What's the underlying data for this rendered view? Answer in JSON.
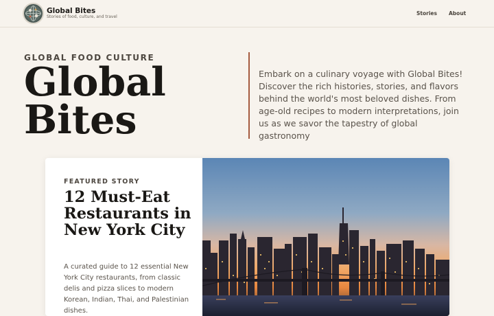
{
  "header": {
    "logo_icon": "globe-logo-icon",
    "title": "Global Bites",
    "tagline": "Stories of food, culture, and travel",
    "nav": [
      {
        "label": "Stories"
      },
      {
        "label": "About"
      }
    ]
  },
  "hero": {
    "eyebrow": "GLOBAL FOOD CULTURE",
    "title": "Global Bites",
    "description": "Embark on a culinary voyage with Global Bites! Discover the rich histories, stories, and flavors behind the world's most beloved dishes. From age-old recipes to modern interpretations, join us as we savor the tapestry of global gastronomy"
  },
  "featured": {
    "eyebrow": "FEATURED STORY",
    "title": "12 Must-Eat Restaurants in New York City",
    "description": "A curated guide to 12 essential New York City restaurants, from classic delis and pizza slices to modern Korean, Indian, Thai, and Palestinian dishes.",
    "image_icon": "new-york-skyline-image"
  },
  "colors": {
    "background": "#f7f3ed",
    "accent_rule": "#a55a3f",
    "text_primary": "#1a1815",
    "text_secondary": "#5a534b"
  }
}
